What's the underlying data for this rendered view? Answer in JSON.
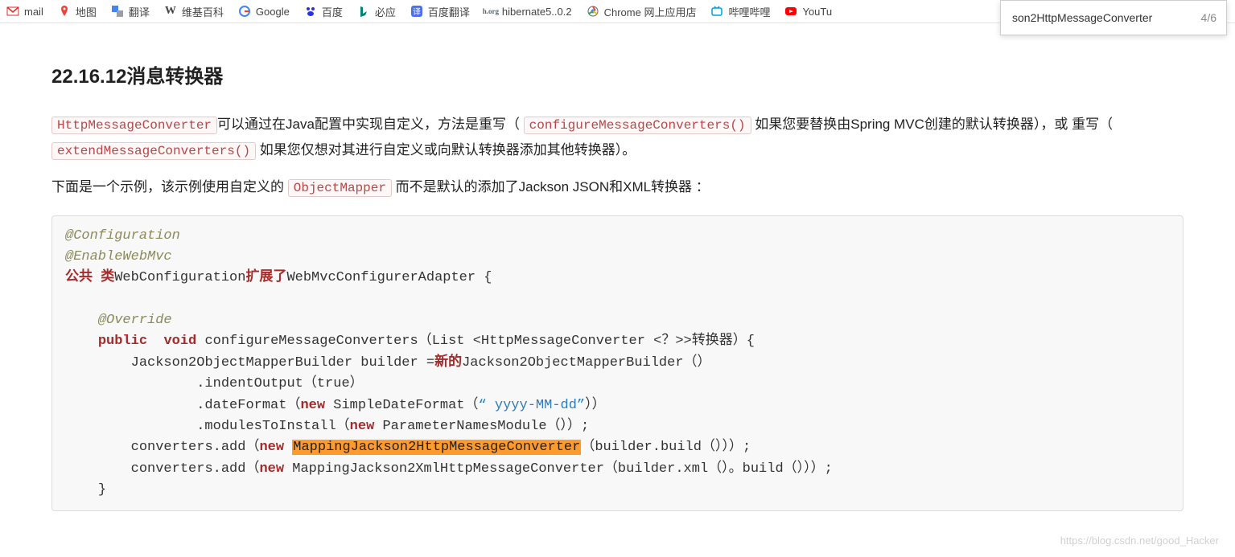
{
  "bookmarks": [
    {
      "label": "mail",
      "icon": "gmail"
    },
    {
      "label": "地图",
      "icon": "gmaps"
    },
    {
      "label": "翻译",
      "icon": "gtranslate"
    },
    {
      "label": "维基百科",
      "icon": "wiki"
    },
    {
      "label": "Google",
      "icon": "google"
    },
    {
      "label": "百度",
      "icon": "baidu"
    },
    {
      "label": "必应",
      "icon": "bing"
    },
    {
      "label": "百度翻译",
      "icon": "baidutrans"
    },
    {
      "label": "hibernate5..0.2",
      "icon": "hibernate"
    },
    {
      "label": "Chrome 网上应用店",
      "icon": "cws"
    },
    {
      "label": "哔哩哔哩",
      "icon": "bilibili"
    },
    {
      "label": "YouTu",
      "icon": "youtube"
    }
  ],
  "find": {
    "query": "son2HttpMessageConverter",
    "result": "4/6"
  },
  "section": {
    "heading": "22.16.12消息转换器",
    "p1_code1": "HttpMessageConverter",
    "p1_text1": "可以通过在Java配置中实现自定义，方法是重写（ ",
    "p1_code2": "configureMessageConverters()",
    "p1_text2": " 如果您要替换由Spring MVC创建的默认转换器），或  重写（ ",
    "p1_code3": "extendMessageConverters()",
    "p1_text3": " 如果您仅想对其进行自定义或向默认转换器添加其他转换器）。",
    "p2_text1": "下面是一个示例，该示例使用自定义的 ",
    "p2_code1": "ObjectMapper",
    "p2_text2": " 而不是默认的添加了Jackson JSON和XML转换器  ："
  },
  "code": {
    "annot1": "@Configuration",
    "annot2": "@EnableWebMvc",
    "kw_public_cn": "公共",
    "kw_class_cn": "类",
    "classname": "WebConfiguration",
    "kw_ext_cn": "扩展了",
    "supername": "WebMvcConfigurerAdapter {",
    "override": "@Override",
    "kw_public": "public",
    "kw_void": "void",
    "method_sig": "configureMessageConverters（List <HttpMessageConverter <？>>",
    "param_cn": "转换器",
    "method_sig_end": "）{",
    "line_builder_a": "Jackson2ObjectMapperBuilder builder =",
    "kw_new_cn": "新的",
    "line_builder_b": "Jackson2ObjectMapperBuilder（）",
    "line_indent": ".indentOutput（true）",
    "line_datefmt_a": ".dateFormat（",
    "kw_new": "new",
    "line_datefmt_b": " SimpleDateFormat（",
    "str_datefmt": "“ yyyy-MM-dd”",
    "line_datefmt_c": "））",
    "line_modules_a": ".modulesToInstall（",
    "line_modules_b": " ParameterNamesModule（））;",
    "line_add1_a": "converters.add（",
    "cls_json": "MappingJackson2HttpMessageConverter",
    "line_add1_b": "（builder.build（）））;",
    "line_add2_a": "converters.add（",
    "cls_xml": "MappingJackson2XmlHttpMessageConverter（builder.xml（）。build（）））;",
    "brace_close": "}"
  },
  "watermark": "https://blog.csdn.net/good_Hacker"
}
